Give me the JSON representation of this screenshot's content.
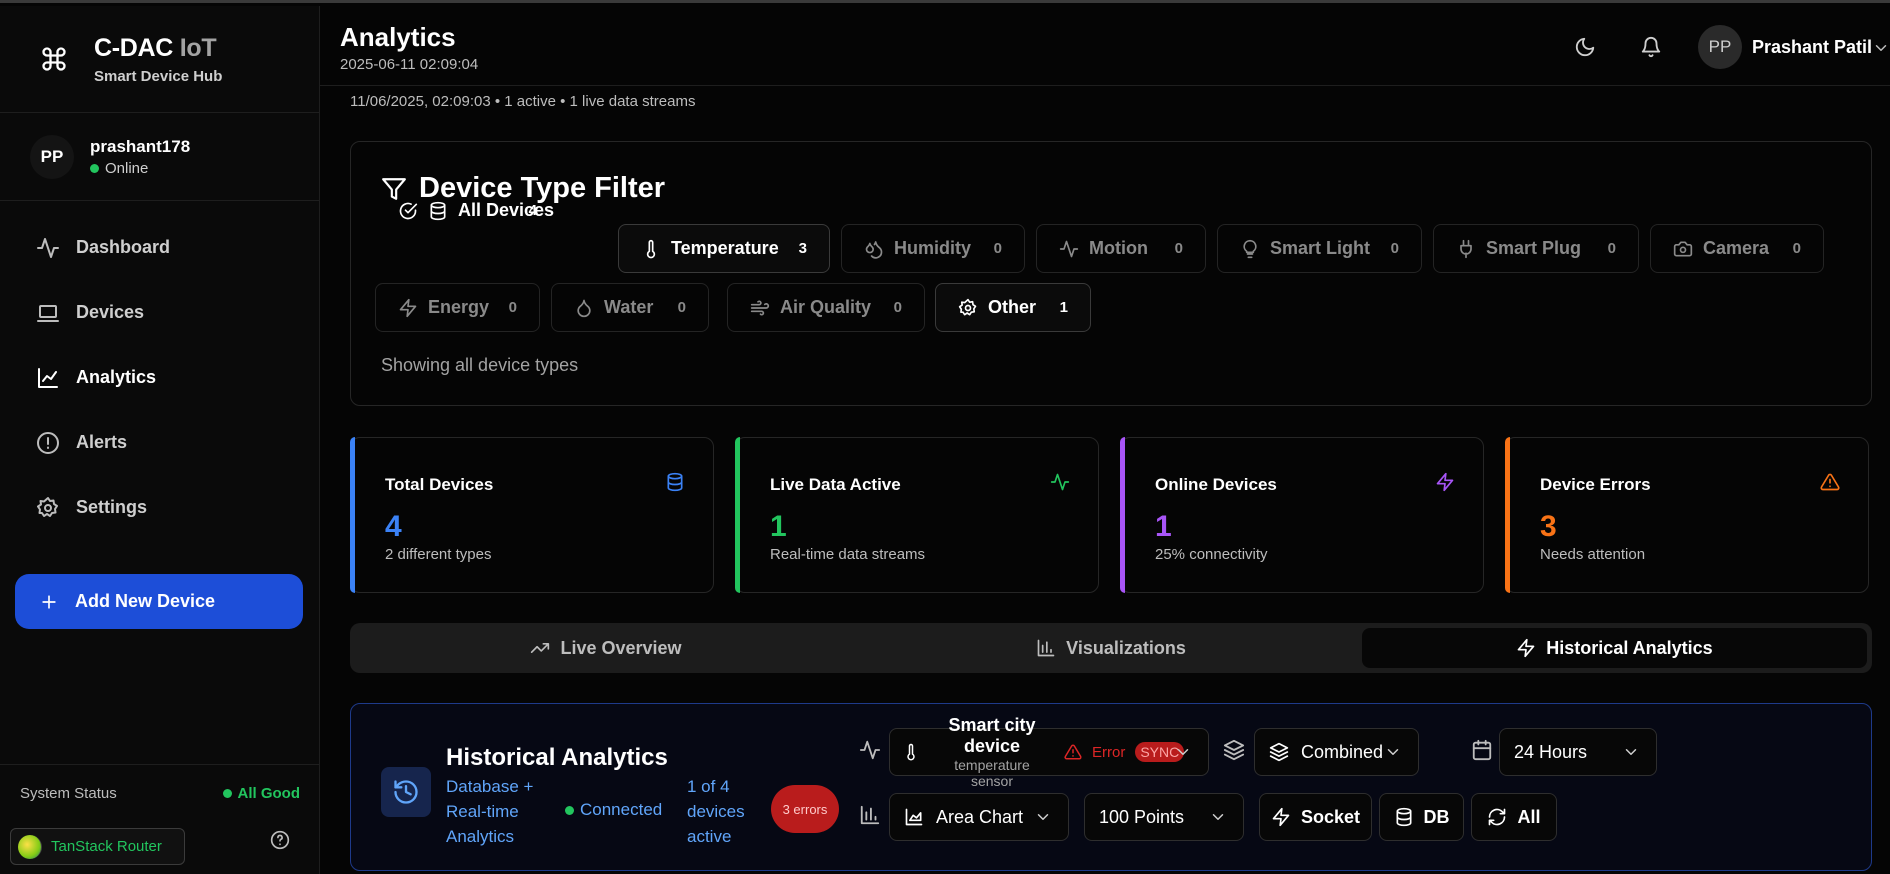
{
  "brand": {
    "name_main": "C-DAC",
    "name_accent": "IoT",
    "tagline": "Smart Device Hub"
  },
  "user": {
    "initials": "PP",
    "username": "prashant178",
    "status": "Online"
  },
  "nav": [
    {
      "label": "Dashboard",
      "icon": "activity-icon"
    },
    {
      "label": "Devices",
      "icon": "laptop-icon"
    },
    {
      "label": "Analytics",
      "icon": "line-chart-icon",
      "active": true
    },
    {
      "label": "Alerts",
      "icon": "alert-circle-icon"
    },
    {
      "label": "Settings",
      "icon": "gear-icon"
    }
  ],
  "add_button": "Add New Device",
  "system_status": {
    "label": "System Status",
    "value": "All Good"
  },
  "devtools": {
    "label": "TanStack Router"
  },
  "header": {
    "title": "Analytics",
    "timestamp": "2025-06-11 02:09:04",
    "user_initials": "PP",
    "user_name": "Prashant Patil"
  },
  "summary": "11/06/2025, 02:09:03 • 1 active • 1 live data streams",
  "filter": {
    "title": "Device Type Filter",
    "chips": [
      {
        "label": "All Devices",
        "count": "4"
      },
      {
        "label": "Temperature",
        "count": "3"
      },
      {
        "label": "Humidity",
        "count": "0"
      },
      {
        "label": "Motion",
        "count": "0"
      },
      {
        "label": "Smart Light",
        "count": "0"
      },
      {
        "label": "Smart Plug",
        "count": "0"
      },
      {
        "label": "Camera",
        "count": "0"
      },
      {
        "label": "Energy",
        "count": "0"
      },
      {
        "label": "Water",
        "count": "0"
      },
      {
        "label": "Air Quality",
        "count": "0"
      },
      {
        "label": "Other",
        "count": "1"
      }
    ],
    "showing": "Showing all device types"
  },
  "stats": [
    {
      "label": "Total Devices",
      "value": "4",
      "sub": "2 different types",
      "color": "#3b82f6"
    },
    {
      "label": "Live Data Active",
      "value": "1",
      "sub": "Real-time data streams",
      "color": "#22c55e"
    },
    {
      "label": "Online Devices",
      "value": "1",
      "sub": "25% connectivity",
      "color": "#a855f7"
    },
    {
      "label": "Device Errors",
      "value": "3",
      "sub": "Needs attention",
      "color": "#f97316"
    }
  ],
  "tabs": [
    {
      "label": "Live Overview"
    },
    {
      "label": "Visualizations"
    },
    {
      "label": "Historical Analytics",
      "active": true
    }
  ],
  "historical": {
    "title": "Historical Analytics",
    "subtitle": "Database + Real-time Analytics",
    "connection": "Connected",
    "active": "1 of 4 devices active",
    "errors": "3 errors",
    "device": {
      "name": "Smart city device",
      "type": "temperature sensor",
      "status": "Error",
      "sync": "SYNC"
    },
    "mode": "Combined",
    "range": "24 Hours",
    "chart_type": "Area Chart",
    "points": "100 Points",
    "buttons": {
      "socket": "Socket",
      "db": "DB",
      "all": "All"
    }
  }
}
